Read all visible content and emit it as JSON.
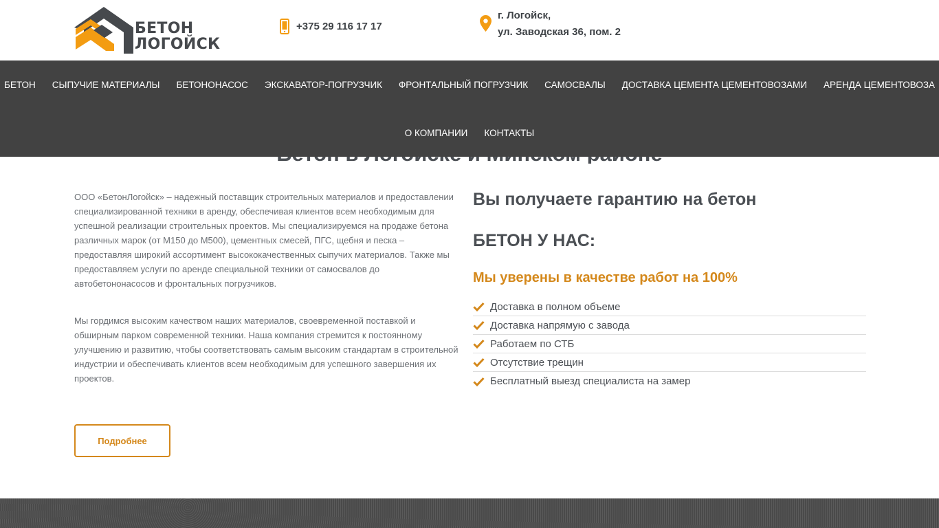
{
  "header": {
    "logo": {
      "line1": "БЕТОН",
      "line2": "ЛОГОЙСК",
      "icon": "logo-chevrons-icon"
    },
    "phone": {
      "icon": "mobile-phone-icon",
      "text": "+375 29 116 17 17"
    },
    "address": {
      "icon": "location-pin-icon",
      "line1": "г. Логойск,",
      "line2": "ул. Заводская 36, пом. 2"
    }
  },
  "nav": {
    "row1": [
      "БЕТОН",
      "СЫПУЧИЕ МАТЕРИАЛЫ",
      "БЕТОНОНАСОС",
      "ЭКСКАВАТОР-ПОГРУЗЧИК",
      "ФРОНТАЛЬНЫЙ ПОГРУЗЧИК",
      "САМОСВАЛЫ",
      "ДОСТАВКА ЦЕМЕНТА ЦЕМЕНТОВОЗАМИ",
      "АРЕНДА ЦЕМЕНТОВОЗА"
    ],
    "row2": [
      "О КОМПАНИИ",
      "КОНТАКТЫ"
    ]
  },
  "section": {
    "heading": "Бетон в Логойске и Минском районе"
  },
  "left": {
    "para1": "ООО «БетонЛогойск» – надежный поставщик строительных материалов и предоставлении специализированной техники в аренду, обеспечивая клиентов всем необходимым для успешной реализации строительных проектов. Мы специализируемся на продаже бетона различных марок (от М150 до М500), цементных смесей, ПГС, щебня и песка – предоставляя широкий ассортимент высококачественных сыпучих материалов. Также мы предоставляем услуги по аренде специальной техники от самосвалов до автобетононасосов и фронтальных погрузчиков.",
    "para2": "Мы гордимся высоким качеством наших материалов, своевременной поставкой и обширным парком современной техники. Наша компания стремится к постоянному улучшению и развитию, чтобы соответствовать самым высоким стандартам в строительной индустрии и обеспечивать клиентов всем необходимым для успешного завершения их проектов.",
    "button": "Подробнее"
  },
  "right": {
    "guarantee": "Вы получаете гарантию на бетон",
    "concrete": "БЕТОН У НАС:",
    "quality": "Мы уверены в качестве работ на 100%",
    "features": [
      "Доставка в полном объеме",
      "Доставка напрямую с завода",
      "Работаем по СТБ",
      "Отсутствие трещин",
      "Бесплатный выезд специалиста на замер"
    ]
  },
  "colors": {
    "accent": "#d4881b",
    "nav_bg": "#424242",
    "text": "#4b4f54"
  }
}
